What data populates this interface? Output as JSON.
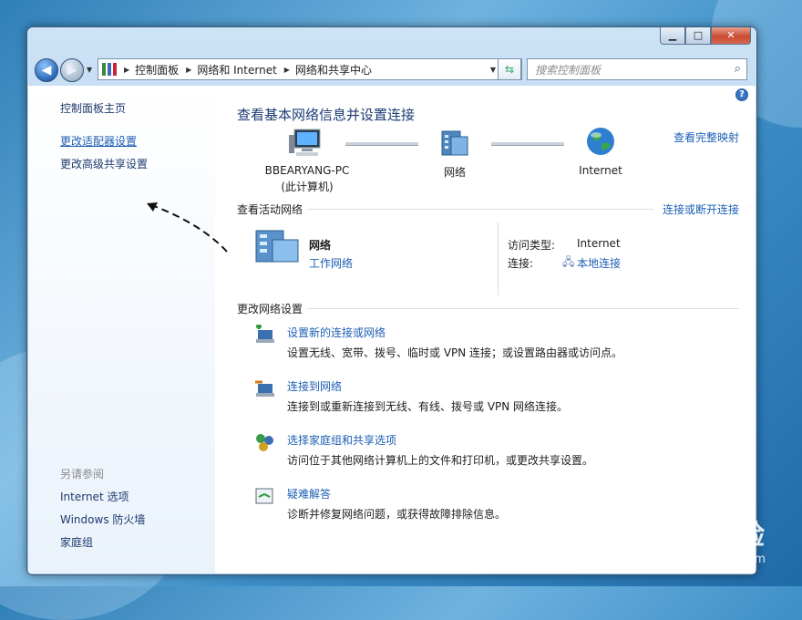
{
  "address": {
    "segments": [
      "控制面板",
      "网络和 Internet",
      "网络和共享中心"
    ]
  },
  "search": {
    "placeholder": "搜索控制面板"
  },
  "sidebar": {
    "home": "控制面板主页",
    "links": [
      "更改适配器设置",
      "更改高级共享设置"
    ],
    "see_also_title": "另请参阅",
    "see_also": [
      "Internet 选项",
      "Windows 防火墙",
      "家庭组"
    ]
  },
  "main": {
    "title": "查看基本网络信息并设置连接",
    "full_map": "查看完整映射",
    "nodes": [
      {
        "label": "BBEARYANG-PC",
        "sub": "(此计算机)"
      },
      {
        "label": "网络",
        "sub": ""
      },
      {
        "label": "Internet",
        "sub": ""
      }
    ],
    "active_title": "查看活动网络",
    "connect_link": "连接或断开连接",
    "network_name": "网络",
    "network_type": "工作网络",
    "access_type_label": "访问类型:",
    "access_type_value": "Internet",
    "connection_label": "连接:",
    "connection_value": "本地连接",
    "change_title": "更改网络设置",
    "tasks": [
      {
        "title": "设置新的连接或网络",
        "desc": "设置无线、宽带、拨号、临时或 VPN 连接；或设置路由器或访问点。",
        "icon": "new-connection-icon"
      },
      {
        "title": "连接到网络",
        "desc": "连接到或重新连接到无线、有线、拨号或 VPN 网络连接。",
        "icon": "connect-network-icon"
      },
      {
        "title": "选择家庭组和共享选项",
        "desc": "访问位于其他网络计算机上的文件和打印机，或更改共享设置。",
        "icon": "homegroup-icon"
      },
      {
        "title": "疑难解答",
        "desc": "诊断并修复网络问题，或获得故障排除信息。",
        "icon": "troubleshoot-icon"
      }
    ]
  },
  "watermark": {
    "brand": "Baidu 经验",
    "url": "jingyan.baidu.com"
  }
}
